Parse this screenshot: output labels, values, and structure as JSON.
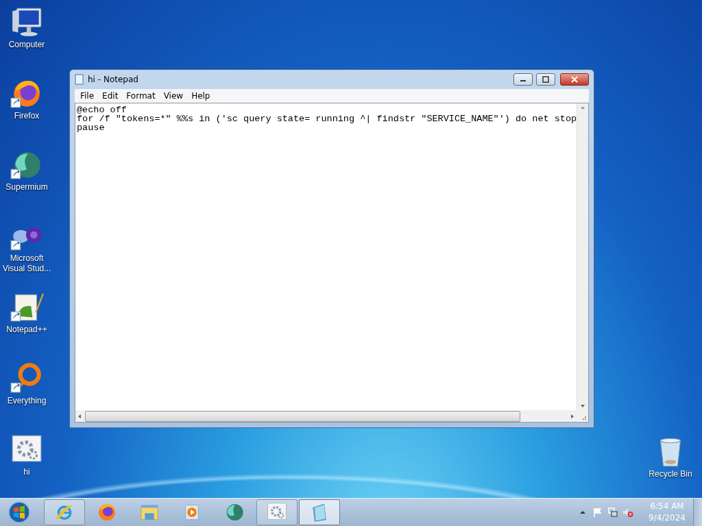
{
  "desktop_icons": [
    {
      "kind": "computer",
      "label": "Computer",
      "shortcut": false
    },
    {
      "kind": "firefox",
      "label": "Firefox",
      "shortcut": true
    },
    {
      "kind": "supermium",
      "label": "Supermium",
      "shortcut": true
    },
    {
      "kind": "visualstudio",
      "label": "Microsoft Visual Stud...",
      "shortcut": true
    },
    {
      "kind": "notepadpp",
      "label": "Notepad++",
      "shortcut": true
    },
    {
      "kind": "everything",
      "label": "Everything",
      "shortcut": true
    },
    {
      "kind": "gearfile",
      "label": "hi",
      "shortcut": false
    }
  ],
  "recycle_bin": {
    "kind": "recycle",
    "label": "Recycle Bin"
  },
  "window": {
    "title": "hi - Notepad",
    "menu": [
      "File",
      "Edit",
      "Format",
      "View",
      "Help"
    ],
    "lines": [
      "@echo off",
      "for /f \"tokens=*\" %%s in ('sc query state= running ^| findstr \"SERVICE_NAME\"') do net stop",
      "pause"
    ]
  },
  "taskbar": {
    "items": [
      {
        "kind": "ie",
        "running": true,
        "selected": false
      },
      {
        "kind": "firefox",
        "running": false,
        "selected": false
      },
      {
        "kind": "explorer",
        "running": false,
        "selected": false
      },
      {
        "kind": "media",
        "running": false,
        "selected": false
      },
      {
        "kind": "supermium",
        "running": false,
        "selected": false
      },
      {
        "kind": "gearfile",
        "running": true,
        "selected": false
      },
      {
        "kind": "notepad",
        "running": true,
        "selected": true
      }
    ],
    "time": "6:54 AM",
    "date": "9/4/2024"
  }
}
